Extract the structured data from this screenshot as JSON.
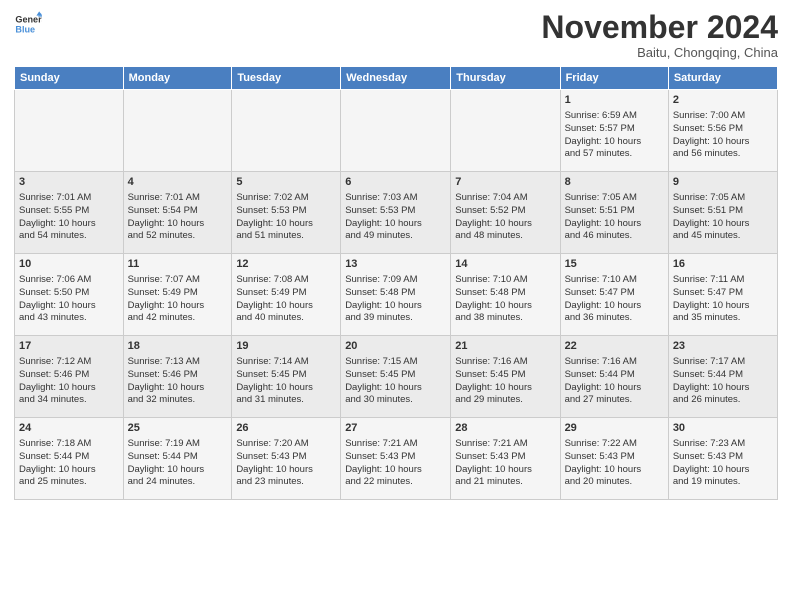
{
  "header": {
    "logo_line1": "General",
    "logo_line2": "Blue",
    "month": "November 2024",
    "location": "Baitu, Chongqing, China"
  },
  "weekdays": [
    "Sunday",
    "Monday",
    "Tuesday",
    "Wednesday",
    "Thursday",
    "Friday",
    "Saturday"
  ],
  "weeks": [
    [
      {
        "day": "",
        "info": ""
      },
      {
        "day": "",
        "info": ""
      },
      {
        "day": "",
        "info": ""
      },
      {
        "day": "",
        "info": ""
      },
      {
        "day": "",
        "info": ""
      },
      {
        "day": "1",
        "info": "Sunrise: 6:59 AM\nSunset: 5:57 PM\nDaylight: 10 hours\nand 57 minutes."
      },
      {
        "day": "2",
        "info": "Sunrise: 7:00 AM\nSunset: 5:56 PM\nDaylight: 10 hours\nand 56 minutes."
      }
    ],
    [
      {
        "day": "3",
        "info": "Sunrise: 7:01 AM\nSunset: 5:55 PM\nDaylight: 10 hours\nand 54 minutes."
      },
      {
        "day": "4",
        "info": "Sunrise: 7:01 AM\nSunset: 5:54 PM\nDaylight: 10 hours\nand 52 minutes."
      },
      {
        "day": "5",
        "info": "Sunrise: 7:02 AM\nSunset: 5:53 PM\nDaylight: 10 hours\nand 51 minutes."
      },
      {
        "day": "6",
        "info": "Sunrise: 7:03 AM\nSunset: 5:53 PM\nDaylight: 10 hours\nand 49 minutes."
      },
      {
        "day": "7",
        "info": "Sunrise: 7:04 AM\nSunset: 5:52 PM\nDaylight: 10 hours\nand 48 minutes."
      },
      {
        "day": "8",
        "info": "Sunrise: 7:05 AM\nSunset: 5:51 PM\nDaylight: 10 hours\nand 46 minutes."
      },
      {
        "day": "9",
        "info": "Sunrise: 7:05 AM\nSunset: 5:51 PM\nDaylight: 10 hours\nand 45 minutes."
      }
    ],
    [
      {
        "day": "10",
        "info": "Sunrise: 7:06 AM\nSunset: 5:50 PM\nDaylight: 10 hours\nand 43 minutes."
      },
      {
        "day": "11",
        "info": "Sunrise: 7:07 AM\nSunset: 5:49 PM\nDaylight: 10 hours\nand 42 minutes."
      },
      {
        "day": "12",
        "info": "Sunrise: 7:08 AM\nSunset: 5:49 PM\nDaylight: 10 hours\nand 40 minutes."
      },
      {
        "day": "13",
        "info": "Sunrise: 7:09 AM\nSunset: 5:48 PM\nDaylight: 10 hours\nand 39 minutes."
      },
      {
        "day": "14",
        "info": "Sunrise: 7:10 AM\nSunset: 5:48 PM\nDaylight: 10 hours\nand 38 minutes."
      },
      {
        "day": "15",
        "info": "Sunrise: 7:10 AM\nSunset: 5:47 PM\nDaylight: 10 hours\nand 36 minutes."
      },
      {
        "day": "16",
        "info": "Sunrise: 7:11 AM\nSunset: 5:47 PM\nDaylight: 10 hours\nand 35 minutes."
      }
    ],
    [
      {
        "day": "17",
        "info": "Sunrise: 7:12 AM\nSunset: 5:46 PM\nDaylight: 10 hours\nand 34 minutes."
      },
      {
        "day": "18",
        "info": "Sunrise: 7:13 AM\nSunset: 5:46 PM\nDaylight: 10 hours\nand 32 minutes."
      },
      {
        "day": "19",
        "info": "Sunrise: 7:14 AM\nSunset: 5:45 PM\nDaylight: 10 hours\nand 31 minutes."
      },
      {
        "day": "20",
        "info": "Sunrise: 7:15 AM\nSunset: 5:45 PM\nDaylight: 10 hours\nand 30 minutes."
      },
      {
        "day": "21",
        "info": "Sunrise: 7:16 AM\nSunset: 5:45 PM\nDaylight: 10 hours\nand 29 minutes."
      },
      {
        "day": "22",
        "info": "Sunrise: 7:16 AM\nSunset: 5:44 PM\nDaylight: 10 hours\nand 27 minutes."
      },
      {
        "day": "23",
        "info": "Sunrise: 7:17 AM\nSunset: 5:44 PM\nDaylight: 10 hours\nand 26 minutes."
      }
    ],
    [
      {
        "day": "24",
        "info": "Sunrise: 7:18 AM\nSunset: 5:44 PM\nDaylight: 10 hours\nand 25 minutes."
      },
      {
        "day": "25",
        "info": "Sunrise: 7:19 AM\nSunset: 5:44 PM\nDaylight: 10 hours\nand 24 minutes."
      },
      {
        "day": "26",
        "info": "Sunrise: 7:20 AM\nSunset: 5:43 PM\nDaylight: 10 hours\nand 23 minutes."
      },
      {
        "day": "27",
        "info": "Sunrise: 7:21 AM\nSunset: 5:43 PM\nDaylight: 10 hours\nand 22 minutes."
      },
      {
        "day": "28",
        "info": "Sunrise: 7:21 AM\nSunset: 5:43 PM\nDaylight: 10 hours\nand 21 minutes."
      },
      {
        "day": "29",
        "info": "Sunrise: 7:22 AM\nSunset: 5:43 PM\nDaylight: 10 hours\nand 20 minutes."
      },
      {
        "day": "30",
        "info": "Sunrise: 7:23 AM\nSunset: 5:43 PM\nDaylight: 10 hours\nand 19 minutes."
      }
    ]
  ]
}
